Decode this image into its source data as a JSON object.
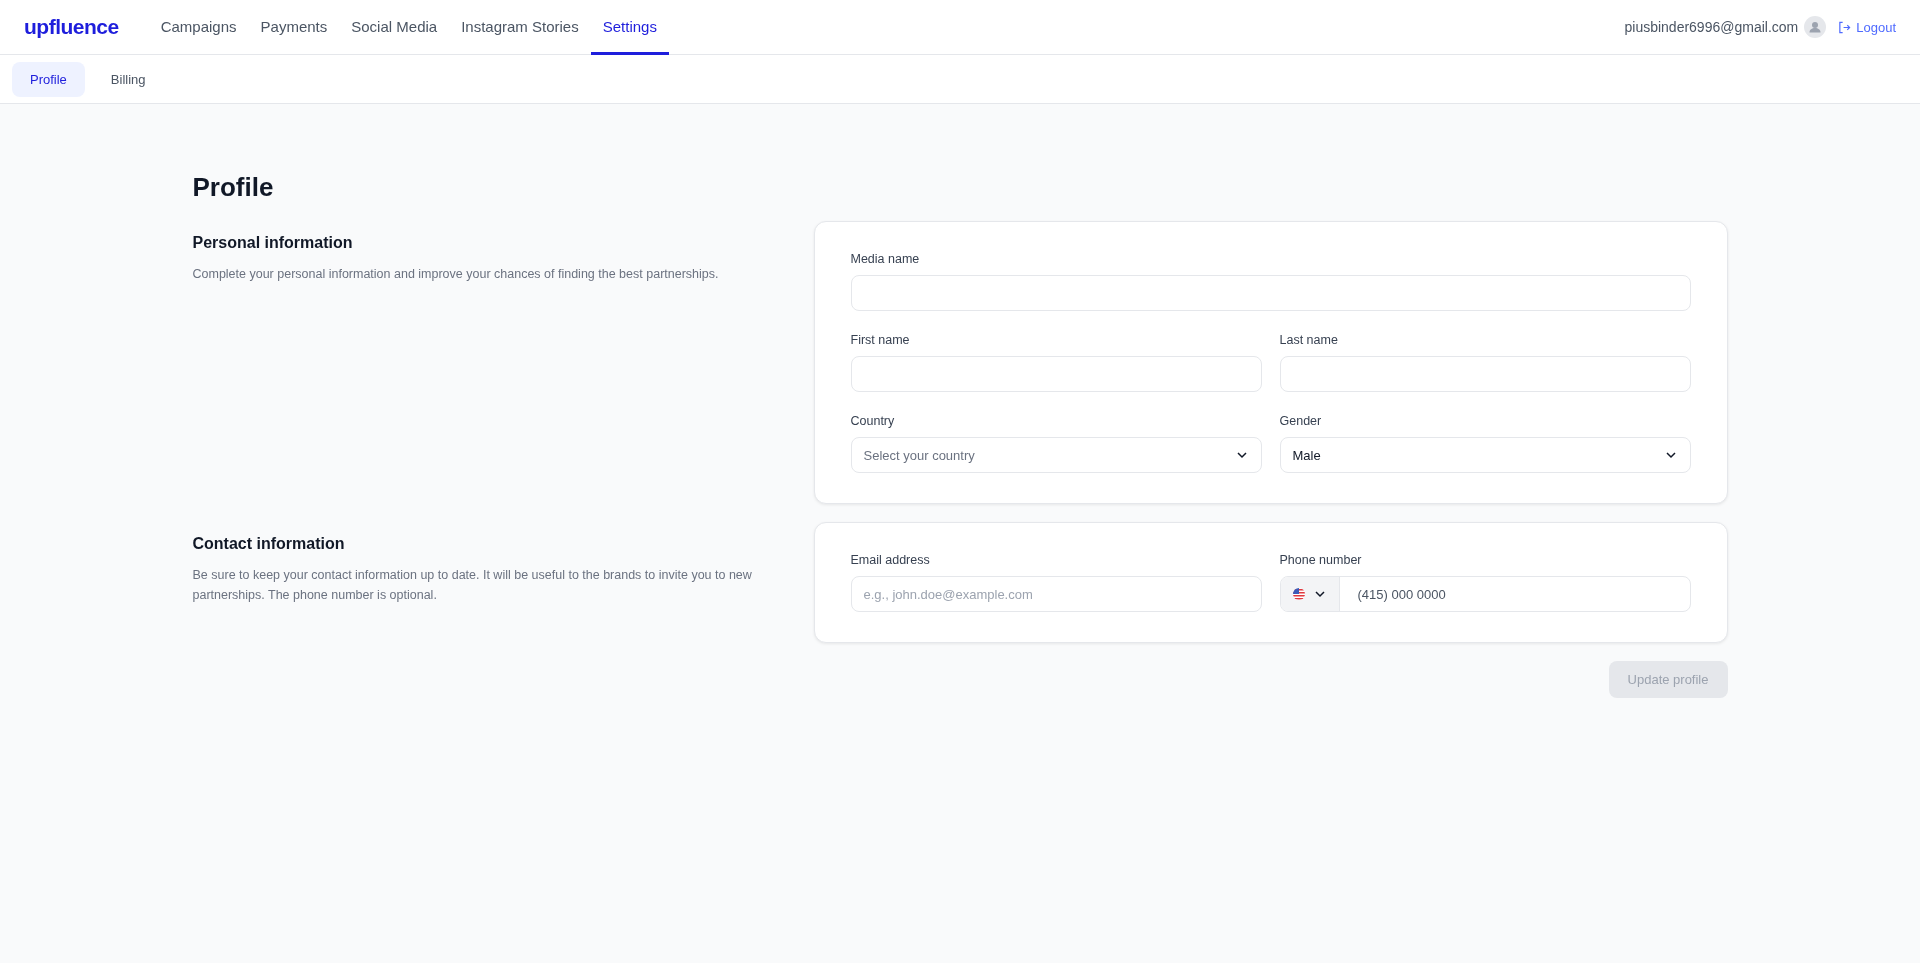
{
  "header": {
    "logo": "upfluence",
    "nav": [
      {
        "label": "Campaigns",
        "selected": false
      },
      {
        "label": "Payments",
        "selected": false
      },
      {
        "label": "Social Media",
        "selected": false
      },
      {
        "label": "Instagram Stories",
        "selected": false
      },
      {
        "label": "Settings",
        "selected": true
      }
    ],
    "email": "piusbinder6996@gmail.com",
    "logout": "Logout"
  },
  "subtabs": [
    {
      "label": "Profile",
      "selected": true
    },
    {
      "label": "Billing",
      "selected": false
    }
  ],
  "title": "Profile",
  "sections": [
    {
      "heading": "Personal information",
      "description": "Complete your personal information and improve your chances of finding the best partnerships.",
      "rows": [
        [
          {
            "kind": "text",
            "label": "Media name"
          }
        ],
        [
          {
            "kind": "text",
            "label": "First name"
          },
          {
            "kind": "text",
            "label": "Last name"
          }
        ],
        [
          {
            "kind": "select",
            "label": "Country",
            "placeholder": "Select your country"
          },
          {
            "kind": "select",
            "label": "Gender",
            "value": "Male"
          }
        ]
      ]
    },
    {
      "heading": "Contact information",
      "description": "Be sure to keep your contact information up to date. It will be useful to the brands to invite you to new partnerships. The phone number is optional.",
      "rows": [
        [
          {
            "kind": "text",
            "label": "Email address",
            "placeholder": "e.g., john.doe@example.com"
          },
          {
            "kind": "phone",
            "label": "Phone number",
            "value": "(415) 000 0000"
          }
        ]
      ]
    }
  ],
  "submit": {
    "label": "Update profile",
    "disabled": true
  }
}
